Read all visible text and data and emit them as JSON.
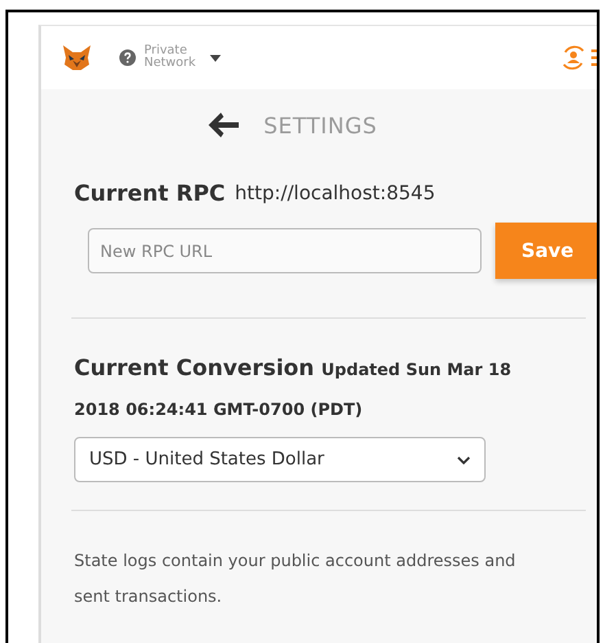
{
  "header": {
    "network": {
      "label": "Private\nNetwork"
    }
  },
  "page_title": "SETTINGS",
  "rpc": {
    "label": "Current RPC",
    "value": "http://localhost:8545",
    "placeholder": "New RPC URL",
    "button": "Save"
  },
  "conversion": {
    "label": "Current Conversion",
    "updated": "Updated Sun Mar 18 2018 06:24:41 GMT-0700 (PDT)",
    "selected_currency": "USD - United States Dollar"
  },
  "state_logs": {
    "text": "State logs contain your public account addresses and sent transactions."
  }
}
